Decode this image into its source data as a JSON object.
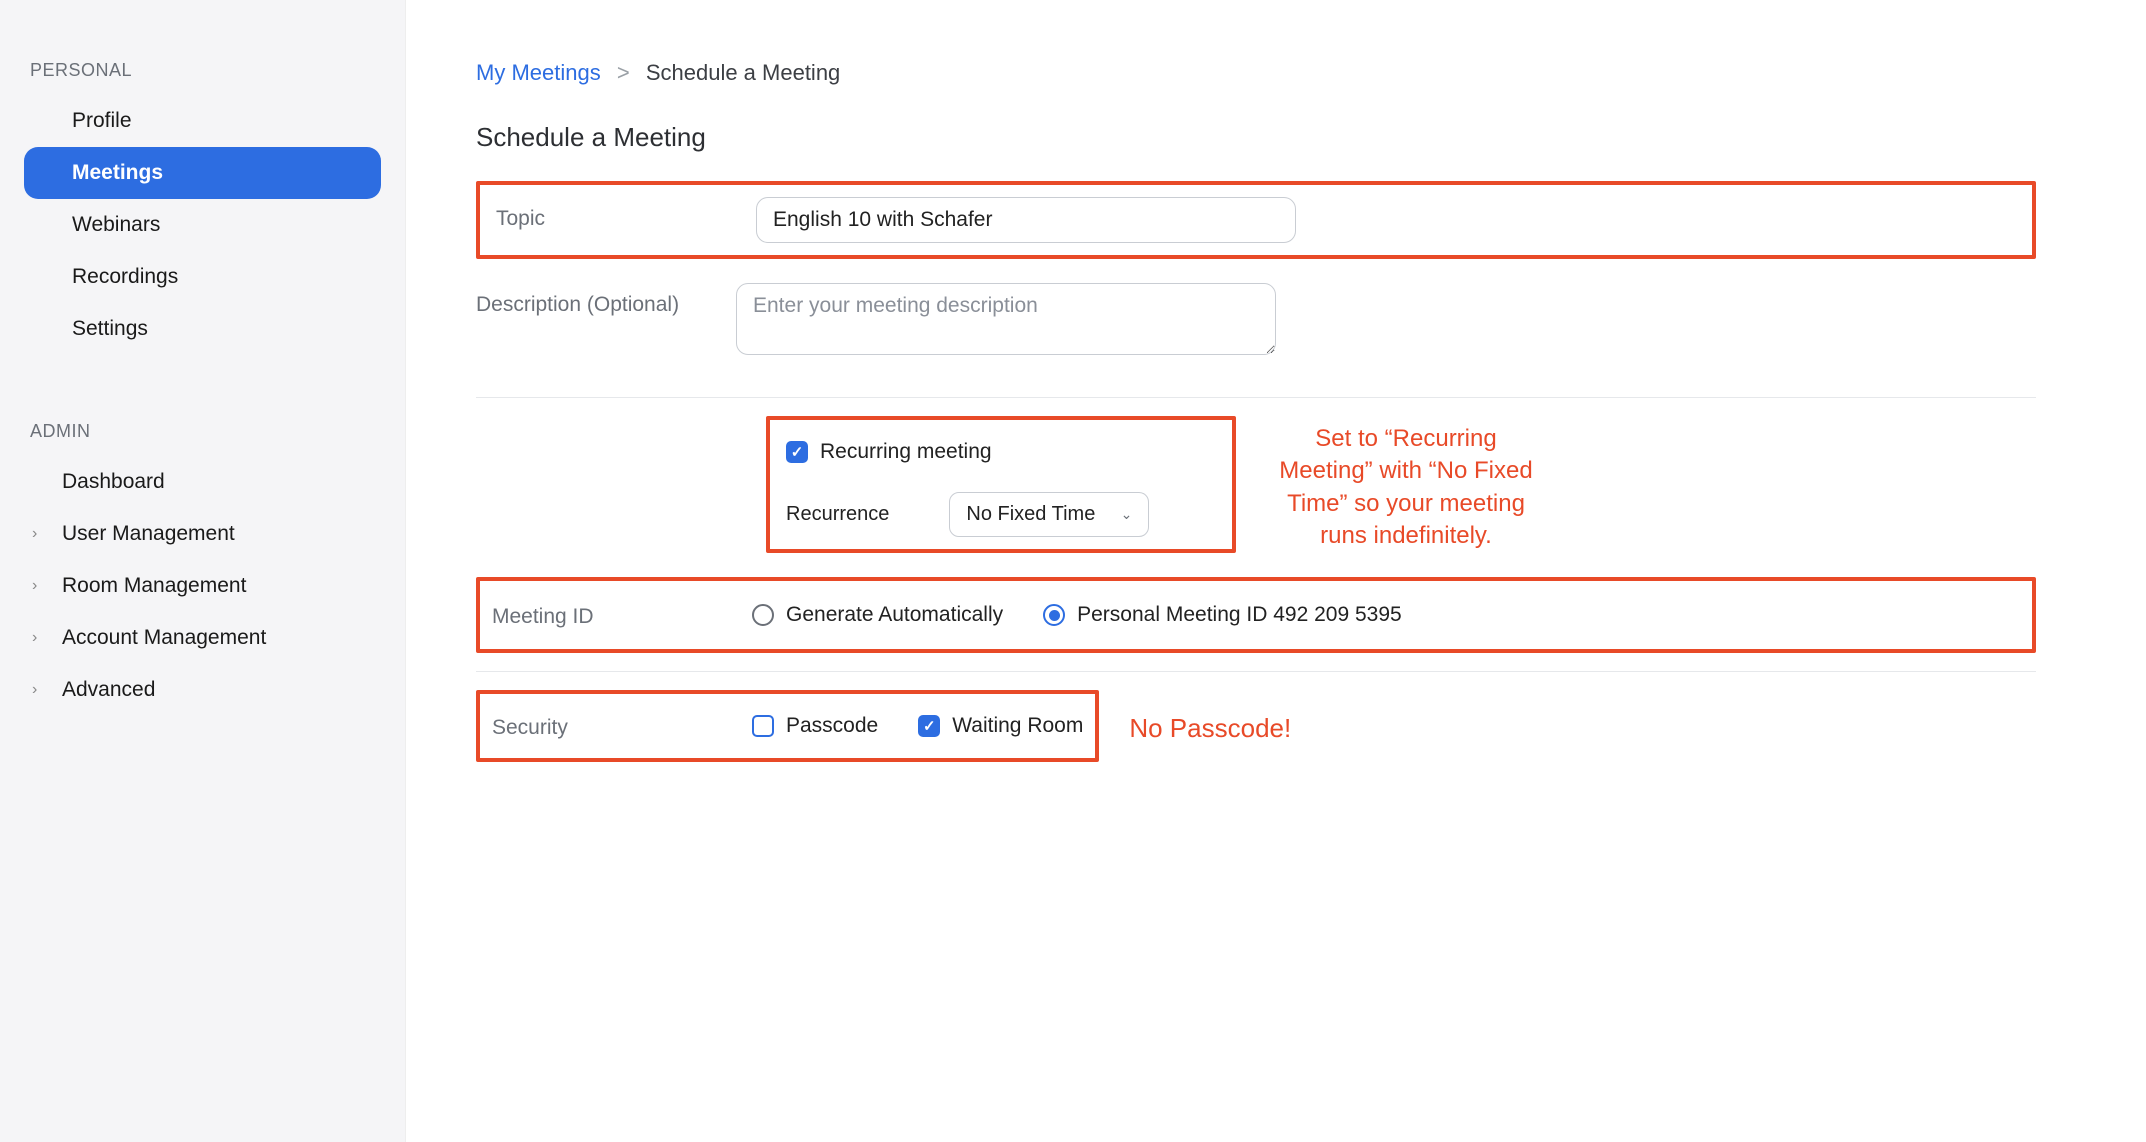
{
  "sidebar": {
    "personal_label": "PERSONAL",
    "admin_label": "ADMIN",
    "items_personal": [
      {
        "label": "Profile"
      },
      {
        "label": "Meetings"
      },
      {
        "label": "Webinars"
      },
      {
        "label": "Recordings"
      },
      {
        "label": "Settings"
      }
    ],
    "items_admin": [
      {
        "label": "Dashboard"
      },
      {
        "label": "User Management"
      },
      {
        "label": "Room Management"
      },
      {
        "label": "Account Management"
      },
      {
        "label": "Advanced"
      }
    ]
  },
  "breadcrumb": {
    "parent": "My Meetings",
    "separator": ">",
    "current": "Schedule a Meeting"
  },
  "page": {
    "title": "Schedule a Meeting"
  },
  "form": {
    "topic_label": "Topic",
    "topic_value": "English 10 with Schafer",
    "description_label": "Description (Optional)",
    "description_placeholder": "Enter your meeting description",
    "recurring_label": "Recurring meeting",
    "recurrence_label": "Recurrence",
    "recurrence_value": "No Fixed Time",
    "meeting_id_label": "Meeting ID",
    "meeting_id_generate": "Generate Automatically",
    "meeting_id_personal": "Personal Meeting ID 492 209 5395",
    "security_label": "Security",
    "passcode_label": "Passcode",
    "waiting_room_label": "Waiting Room"
  },
  "annotations": {
    "recurring_tip": "Set to “Recurring Meeting” with “No Fixed Time” so your meeting runs indefinitely.",
    "no_passcode": "No Passcode!"
  }
}
